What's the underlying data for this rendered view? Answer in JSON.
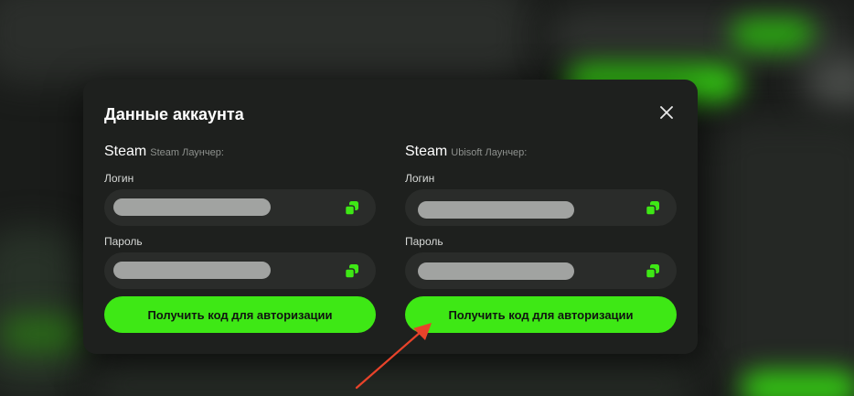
{
  "modal": {
    "title": "Данные аккаунта",
    "accounts": [
      {
        "launcher": "Steam",
        "launcher_caption": "Steam Лаунчер:",
        "login_label": "Логин",
        "password_label": "Пароль",
        "auth_button_label": "Получить код для авторизации",
        "icons": {
          "copy": "copy-icon"
        }
      },
      {
        "launcher": "Steam",
        "launcher_caption": "Ubisoft Лаунчер:",
        "login_label": "Логин",
        "password_label": "Пароль",
        "auth_button_label": "Получить код для авторизации",
        "icons": {
          "copy": "copy-icon"
        }
      }
    ],
    "icons": {
      "close": "close-icon"
    }
  },
  "colors": {
    "accent": "#3ee815",
    "modal_bg": "#1e201e",
    "field_bg": "#2a2c2a",
    "annotation_arrow": "#e8432a"
  }
}
